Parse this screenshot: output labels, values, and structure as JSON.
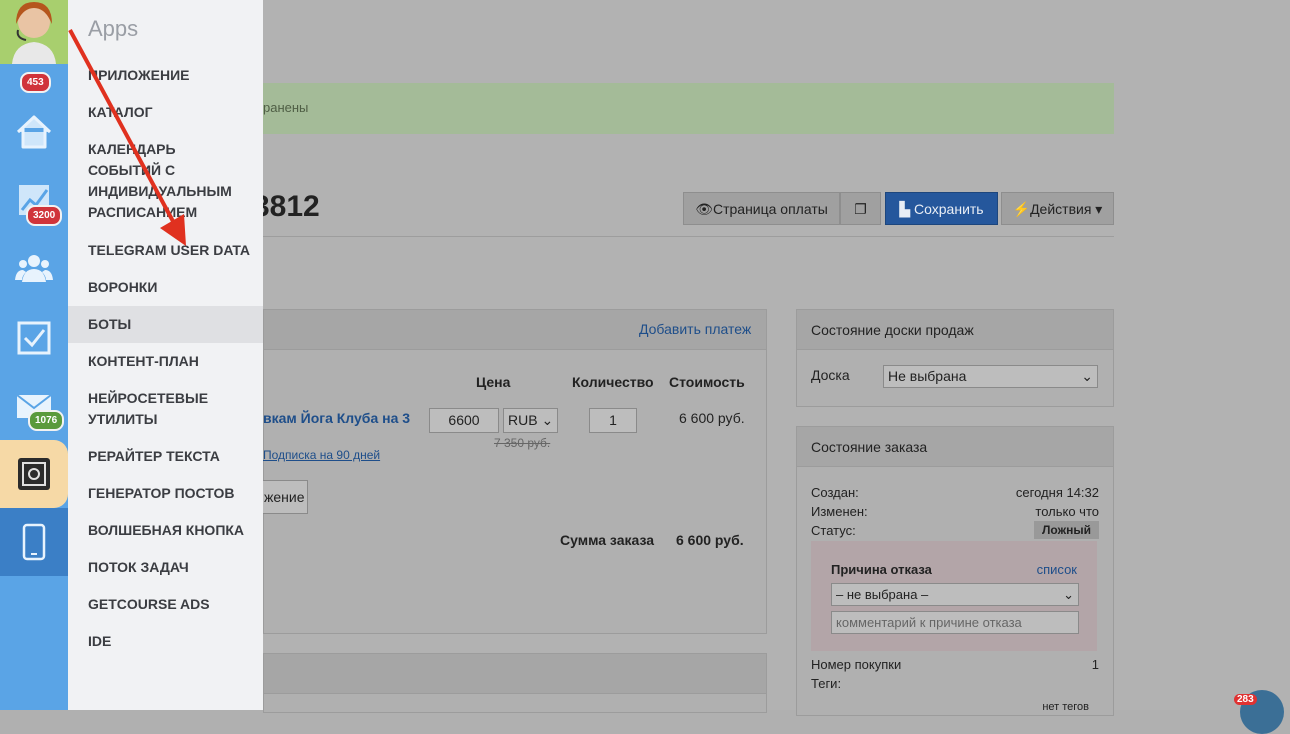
{
  "menu": {
    "title": "Apps",
    "items": [
      "ПРИЛОЖЕНИЕ",
      "КАТАЛОГ",
      "КАЛЕНДАРЬ СОБЫТИЙ С ИНДИВИДУАЛЬНЫМ РАСПИСАНИЕМ",
      "TELEGRAM USER DATA",
      "ВОРОНКИ",
      "БОТЫ",
      "КОНТЕНТ-ПЛАН",
      "НЕЙРОСЕТЕВЫЕ УТИЛИТЫ",
      "РЕРАЙТЕР ТЕКСТА",
      "ГЕНЕРАТОР ПОСТОВ",
      "ВОЛШЕБНАЯ КНОПКА",
      "ПОТОК ЗАДАЧ",
      "GETCOURSE ADS",
      "IDE"
    ]
  },
  "rail": {
    "badges": {
      "top": "453",
      "stats": "3200",
      "mail": "1076"
    },
    "icons": [
      "avatar",
      "home-icon",
      "chart-icon",
      "users-icon",
      "tasks-icon",
      "mail-icon",
      "apps-icon",
      "phone-icon"
    ]
  },
  "main": {
    "alert": "ранены",
    "order_title": "3812",
    "buttons": {
      "payment_page": "Страница оплаты",
      "save": "Сохранить",
      "actions": "Действия"
    },
    "add_payment": "Добавить платеж",
    "table": {
      "headers": [
        "Цена",
        "Количество",
        "Стоимость"
      ],
      "product": "вкам Йога Клуба на 3",
      "subscription": "Подписка на 90 дней",
      "price": "6600",
      "currency": "RUB",
      "old_price": "7 350 руб.",
      "quantity": "1",
      "cost": "6 600 руб.",
      "partial_button": "жение",
      "total_label": "Сумма заказа",
      "total_value": "6 600 руб."
    },
    "board_panel": {
      "title": "Состояние доски продаж",
      "board_label": "Доска",
      "board_value": "Не выбрана"
    },
    "order_state": {
      "title": "Состояние заказа",
      "created_label": "Создан:",
      "created_value": "сегодня 14:32",
      "changed_label": "Изменен:",
      "changed_value": "только что",
      "status_label": "Статус:",
      "status_value": "Ложный",
      "reason_title": "Причина отказа",
      "reason_link": "список",
      "reason_value": "– не выбрана –",
      "reason_placeholder": "комментарий к причине отказа",
      "purchase_label": "Номер покупки",
      "purchase_value": "1",
      "tags_label": "Теги:",
      "tags_value": "нет тегов"
    }
  },
  "chat_badge": "283"
}
